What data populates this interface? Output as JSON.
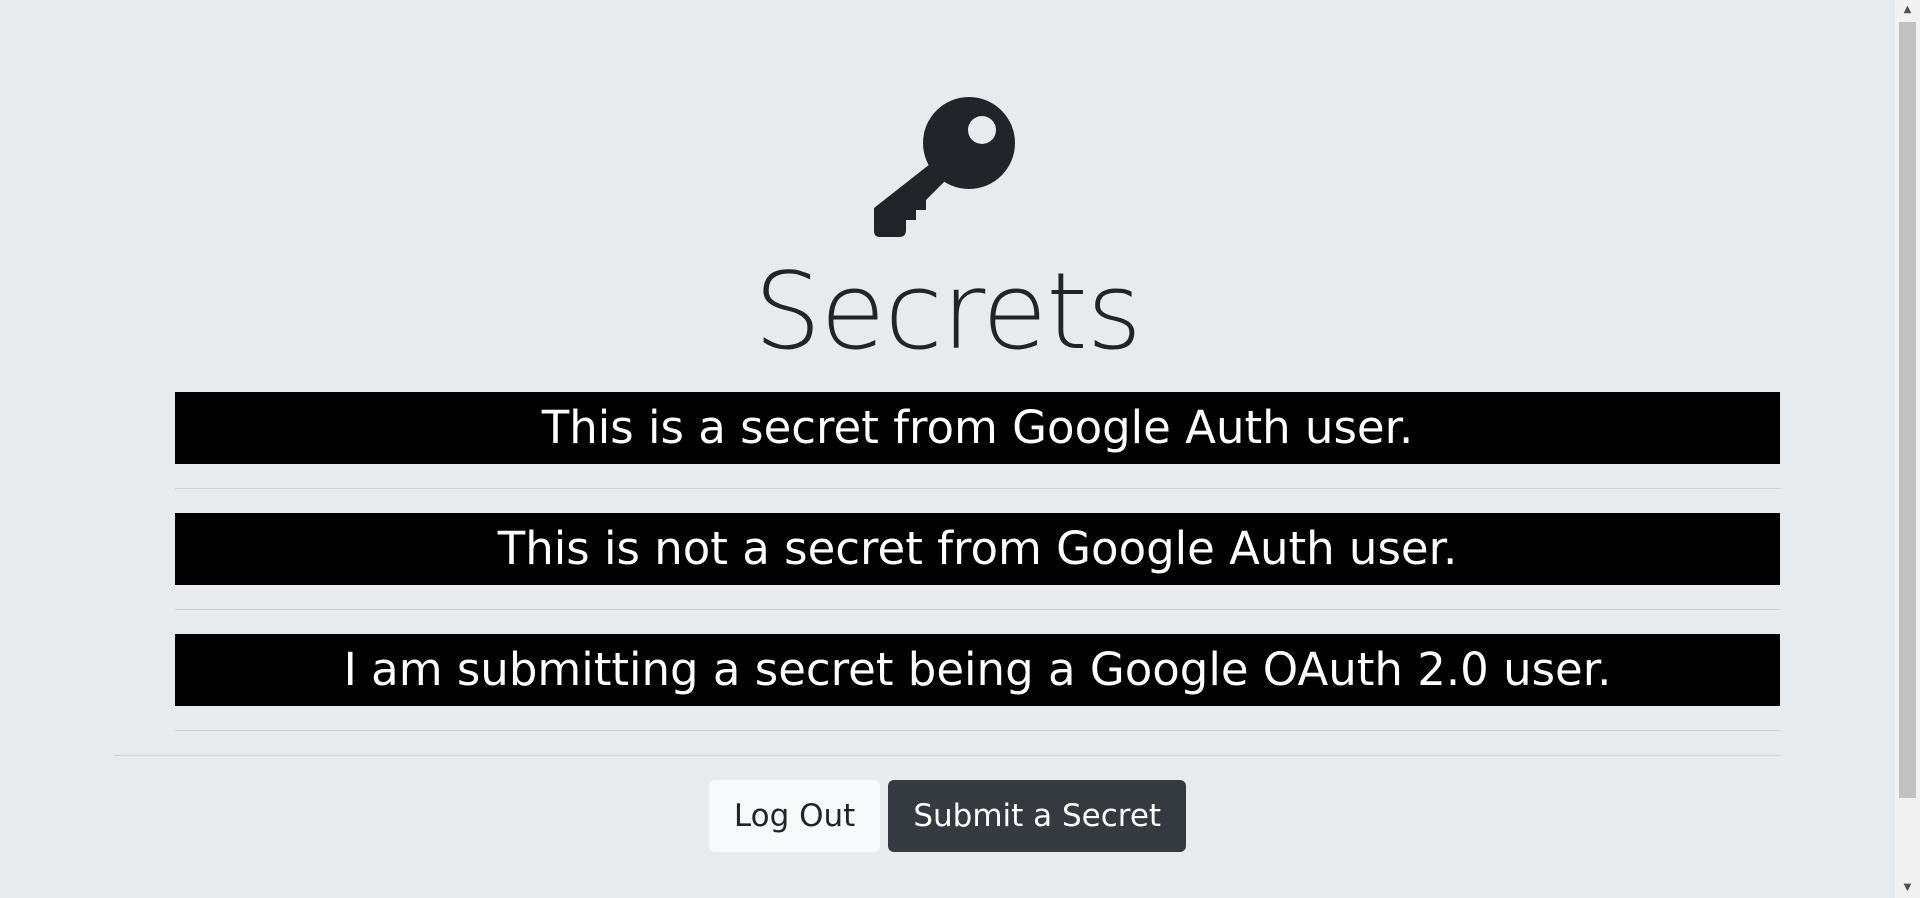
{
  "page": {
    "title": "Secrets",
    "icon": "key-icon"
  },
  "secrets": [
    "This is a secret from Google Auth user.",
    "This is not a secret from Google Auth user.",
    "I am submitting a secret being a Google OAuth 2.0 user."
  ],
  "actions": {
    "logout_label": "Log Out",
    "submit_label": "Submit a Secret"
  },
  "colors": {
    "background": "#e8ebee",
    "secret_background": "#000000",
    "secret_text": "#ffffff",
    "light_button": "#f8f9fa",
    "dark_button": "#343a40"
  }
}
